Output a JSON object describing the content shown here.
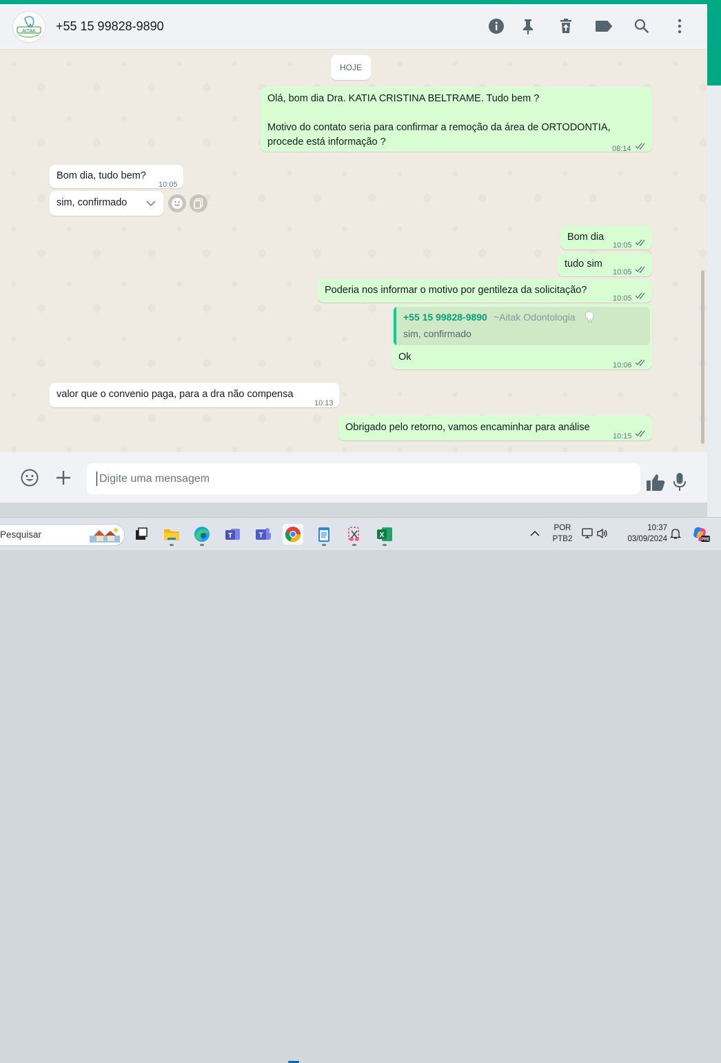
{
  "header": {
    "contact_name": "+55 15 99828-9890",
    "icons": [
      "info-icon",
      "pin-icon",
      "delete-icon",
      "label-icon",
      "search-icon",
      "menu-icon"
    ]
  },
  "chat": {
    "date_separator": "HOJE",
    "messages": [
      {
        "direction": "out",
        "lines": [
          "Olá, bom dia Dra.  KATIA CRISTINA BELTRAME. Tudo bem ?",
          "",
          "Motivo do contato seria para confirmar a remoção da área de ORTODONTIA,",
          "procede está informação ?"
        ],
        "time": "08:14"
      },
      {
        "direction": "in",
        "text": "Bom dia, tudo bem?",
        "time": "10:05"
      },
      {
        "direction": "in",
        "text": "sim, confirmado",
        "time": ""
      },
      {
        "direction": "out",
        "text": "Bom dia",
        "time": "10:05"
      },
      {
        "direction": "out",
        "text": "tudo sim",
        "time": "10:05"
      },
      {
        "direction": "out",
        "text": "Poderia nos informar o motivo por gentileza da solicitação?",
        "time": "10:05"
      },
      {
        "direction": "out",
        "quote": {
          "author": "+55 15 99828-9890",
          "author_suffix": "~Aitak Odontologia",
          "text": "sim, confirmado"
        },
        "text": "Ok",
        "time": "10:06"
      },
      {
        "direction": "in",
        "text": "valor que o convenio paga, para a dra não compensa",
        "time": "10:13"
      },
      {
        "direction": "out",
        "text": "Obrigado pelo retorno, vamos encaminhar para análise",
        "time": "10:15"
      }
    ]
  },
  "composer": {
    "placeholder": "Digite uma mensagem"
  },
  "taskbar": {
    "search_placeholder": "Pesquisar",
    "apps": [
      "task-view",
      "file-explorer",
      "edge",
      "teams-classic",
      "teams",
      "chrome",
      "notepad",
      "snipping-tool",
      "excel"
    ],
    "language": "POR",
    "layout": "PTB2",
    "time": "10:37",
    "date": "03/09/2024"
  },
  "colors": {
    "accent": "#00a884",
    "outgoing": "#d9fdd3",
    "incoming": "#ffffff",
    "tick": "#53bdeb"
  }
}
